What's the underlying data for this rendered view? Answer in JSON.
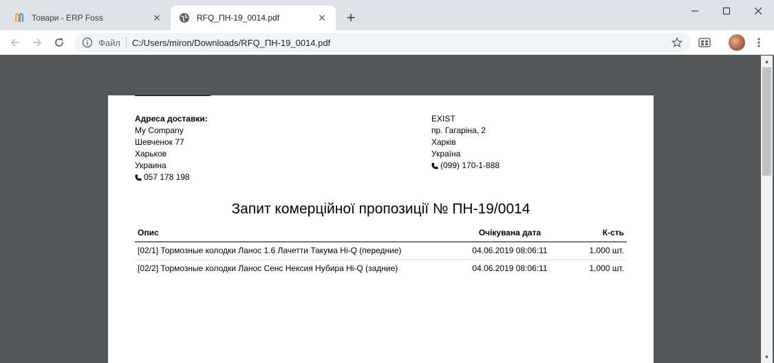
{
  "browser": {
    "tabs": [
      {
        "title": "Товари - ERP Foss",
        "icon": "erp-logo-icon",
        "active": false
      },
      {
        "title": "RFQ_ПН-19_0014.pdf",
        "icon": "globe-icon",
        "active": true
      }
    ],
    "new_tab": "+",
    "window_controls": {
      "minimize": "minimize-icon",
      "maximize": "maximize-icon",
      "close": "close-icon"
    },
    "omnibox": {
      "scheme_label": "Файл",
      "url": "C:/Users/miron/Downloads/RFQ_ПН-19_0014.pdf"
    }
  },
  "document": {
    "delivery": {
      "heading": "Адреса доставки:",
      "lines": [
        "My Company",
        "Шевченок 77",
        "Харьков",
        "Украина"
      ],
      "phone": "057 178 198"
    },
    "vendor": {
      "lines": [
        "EXIST",
        "пр. Гагаріна, 2",
        "Харків",
        "Україна"
      ],
      "phone": "(099) 170-1-888"
    },
    "title": "Запит комерційної пропозиції № ПН-19/0014",
    "table": {
      "headers": {
        "description": "Опис",
        "date": "Очікувана дата",
        "qty": "К-сть"
      },
      "rows": [
        {
          "description": "[02/1] Тормозные колодки Ланос 1.6 Лачетти Такума Hi-Q (передние)",
          "date": "04.06.2019 08:06:11",
          "qty": "1,000 шт."
        },
        {
          "description": "[02/2] Тормозные колодки Ланос Сенс Нексия Нубира Hi-Q (задние)",
          "date": "04.06.2019 08:06:11",
          "qty": "1,000 шт."
        }
      ]
    }
  },
  "colors": {
    "viewer_bg": "#525659",
    "tabstrip_bg": "#dee1e6",
    "omnibox_bg": "#f1f3f4"
  }
}
